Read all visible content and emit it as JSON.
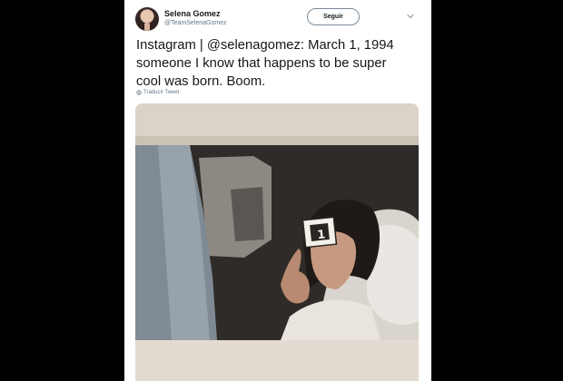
{
  "user": {
    "name": "Selena Gomez",
    "handle": "@TeamSelenaGomez",
    "avatar_icon": "avatar"
  },
  "follow_button": {
    "label": "Seguir"
  },
  "menu_icon": "chevron-down-icon",
  "tweet": {
    "lines": [
      "Instagram | @selenagomez: March 1, 1994",
      "someone I know that happens to be super",
      "cool was born. Boom."
    ]
  },
  "translate": {
    "label": "Traducir Tweet",
    "icon": "globe-icon"
  },
  "media": {
    "description_icon": "photo",
    "card_number": "1"
  },
  "colors": {
    "background": "#000000",
    "card": "#ffffff",
    "text": "#14171a",
    "muted": "#657786"
  }
}
